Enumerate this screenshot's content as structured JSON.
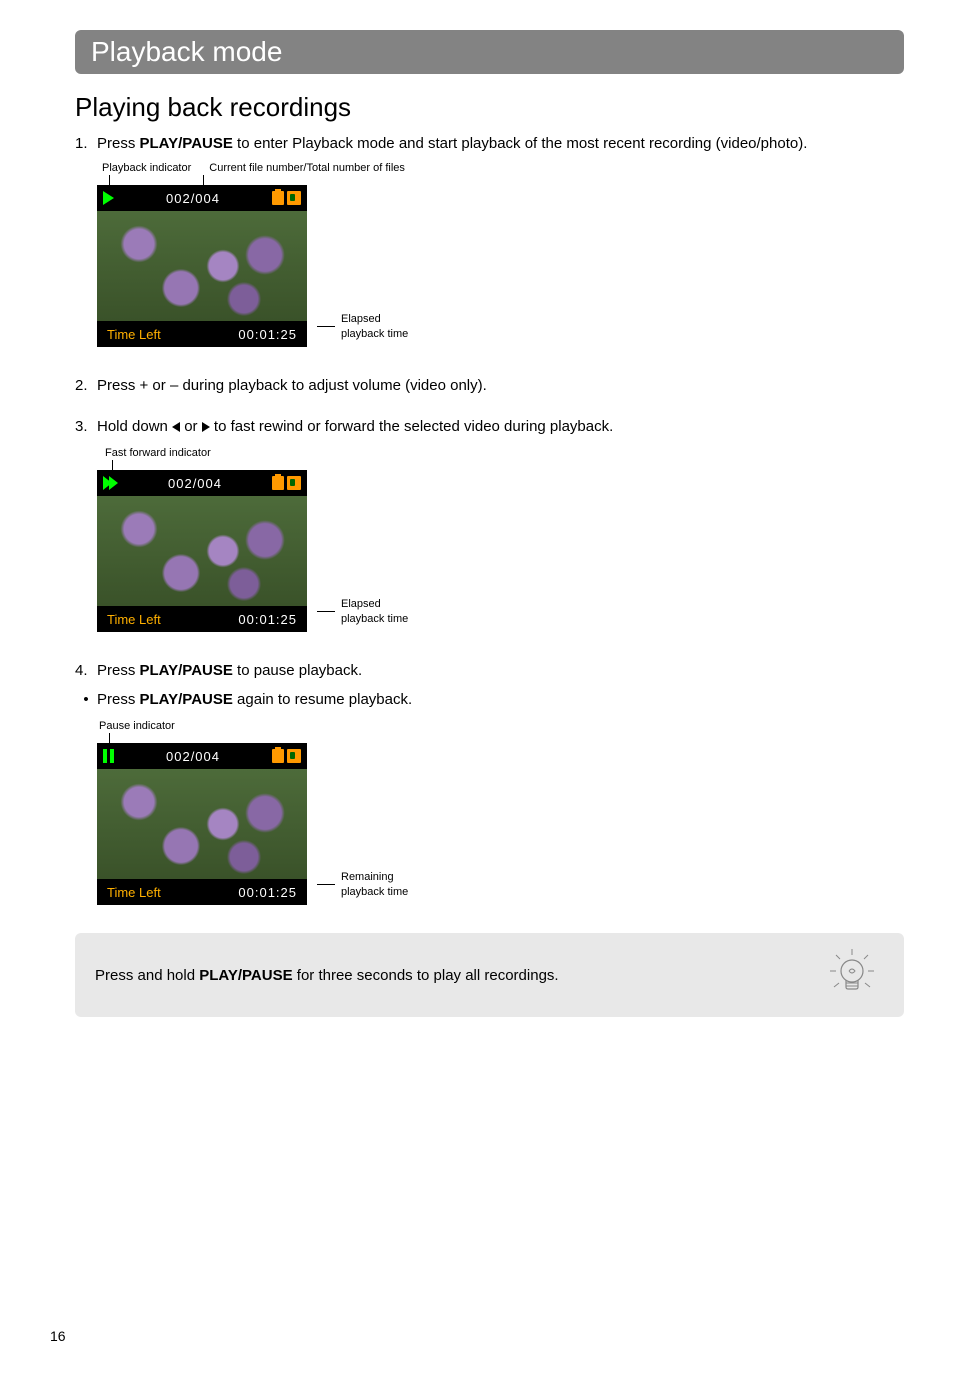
{
  "header": {
    "title": "Playback mode"
  },
  "section": {
    "title": "Playing back recordings"
  },
  "steps": {
    "s1": {
      "num": "1.",
      "pre": "Press ",
      "bold": "PLAY/PAUSE",
      "post": " to enter Playback mode and start playback of the most recent recording (video/photo)."
    },
    "s2": {
      "num": "2.",
      "text": "Press + or – during playback to adjust volume (video only)."
    },
    "s3": {
      "num": "3.",
      "pre": "Hold down ",
      "mid": " or ",
      "post": " to fast rewind or forward the selected video during playback."
    },
    "s4": {
      "num": "4.",
      "pre": "Press ",
      "bold": "PLAY/PAUSE",
      "post": " to pause playback."
    },
    "b1": {
      "bul": "•",
      "pre": "Press ",
      "bold": "PLAY/PAUSE",
      "post": " again to resume playback."
    }
  },
  "screens": {
    "a": {
      "label_left": "Playback indicator",
      "label_right": "Current file number/Total number of files",
      "counter": "002/004",
      "time_left": "Time Left",
      "time": "00:01:25",
      "side1": "Elapsed",
      "side2": "playback time"
    },
    "b": {
      "label": "Fast forward indicator",
      "counter": "002/004",
      "time_left": "Time Left",
      "time": "00:01:25",
      "side1": "Elapsed",
      "side2": "playback time"
    },
    "c": {
      "label": "Pause indicator",
      "counter": "002/004",
      "time_left": "Time Left",
      "time": "00:01:25",
      "side1": "Remaining",
      "side2": "playback time"
    }
  },
  "tip": {
    "pre": "Press and hold ",
    "bold": "PLAY/PAUSE",
    "post": " for three seconds to play all recordings."
  },
  "page": "16"
}
